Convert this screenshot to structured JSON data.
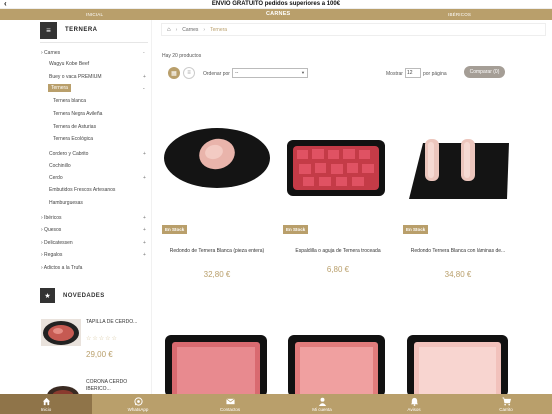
{
  "promo": {
    "back_icon": "chevron-left-icon",
    "text": "ENVIO GRATUITO pedidos superiores a 100€"
  },
  "nav": {
    "left": "INICIAL",
    "center": "CARNES",
    "right": "IBÉRICOS"
  },
  "sidebar": {
    "title": "TERNERA",
    "categories": [
      {
        "label": "› Carnes",
        "plus": "-"
      },
      {
        "label": "Wagyu Kobe Beef",
        "plus": ""
      },
      {
        "label": "Buey o vaca PREMIUM",
        "plus": "+"
      },
      {
        "label": "Ternera",
        "plus": "-"
      },
      {
        "label": "Ternera blanca",
        "plus": ""
      },
      {
        "label": "Ternera Negra Avileña",
        "plus": ""
      },
      {
        "label": "Ternera de Asturias",
        "plus": ""
      },
      {
        "label": "Ternera Ecológica",
        "plus": ""
      },
      {
        "label": "Cordero y Cabrito",
        "plus": "+"
      },
      {
        "label": "Cochinillo",
        "plus": ""
      },
      {
        "label": "Cerdo",
        "plus": "+"
      },
      {
        "label": "Embutidos Frescos Artesanos",
        "plus": ""
      },
      {
        "label": "Hamburguesas",
        "plus": ""
      },
      {
        "label": "› Ibéricos",
        "plus": "+"
      },
      {
        "label": "› Quesos",
        "plus": "+"
      },
      {
        "label": "› Delicatessen",
        "plus": "+"
      },
      {
        "label": "› Regalos",
        "plus": "+"
      },
      {
        "label": "› Adictos a la Trufa",
        "plus": ""
      }
    ],
    "novedades_title": "NOVEDADES",
    "novedades": [
      {
        "name": "TAPILLA DE CERDO...",
        "stars": "☆☆☆☆☆",
        "price": "29,00 €"
      },
      {
        "name": "CORONA CERDO",
        "name2": "IBERICO..."
      }
    ]
  },
  "breadcrumb": {
    "home_icon": "home-icon",
    "items": [
      "Carnes",
      "Ternera"
    ]
  },
  "product_count": "Hay 20 productos",
  "toolbar": {
    "order_label": "Ordenar por",
    "order_value": "--",
    "show_label": "Mostrar",
    "show_value": "12",
    "per_page": "por página",
    "compare": "Comparar (0)"
  },
  "products": [
    {
      "badge": "En Stock",
      "name": "Redondo de Ternera Blanca (pieza entera)",
      "price": "32,80 €"
    },
    {
      "badge": "En Stock",
      "name": "Espaldilla o aguja de Ternera troceada",
      "price": "6,80 €"
    },
    {
      "badge": "En Stock",
      "name": "Redondo Ternera Blanca con láminas de...",
      "price": "34,80 €"
    }
  ],
  "bottom_tabs": [
    {
      "label": "Inicio",
      "icon": "home-icon"
    },
    {
      "label": "WhatsApp",
      "icon": "whatsapp-icon"
    },
    {
      "label": "Contactos",
      "icon": "mail-icon"
    },
    {
      "label": "Mi cuenta",
      "icon": "user-icon"
    },
    {
      "label": "Avisos",
      "icon": "bell-icon"
    },
    {
      "label": "Carrito",
      "icon": "cart-icon"
    }
  ],
  "colors": {
    "gold": "#b99f6b",
    "dark_gold": "#8f7449",
    "meat": "#e8a8a0"
  }
}
